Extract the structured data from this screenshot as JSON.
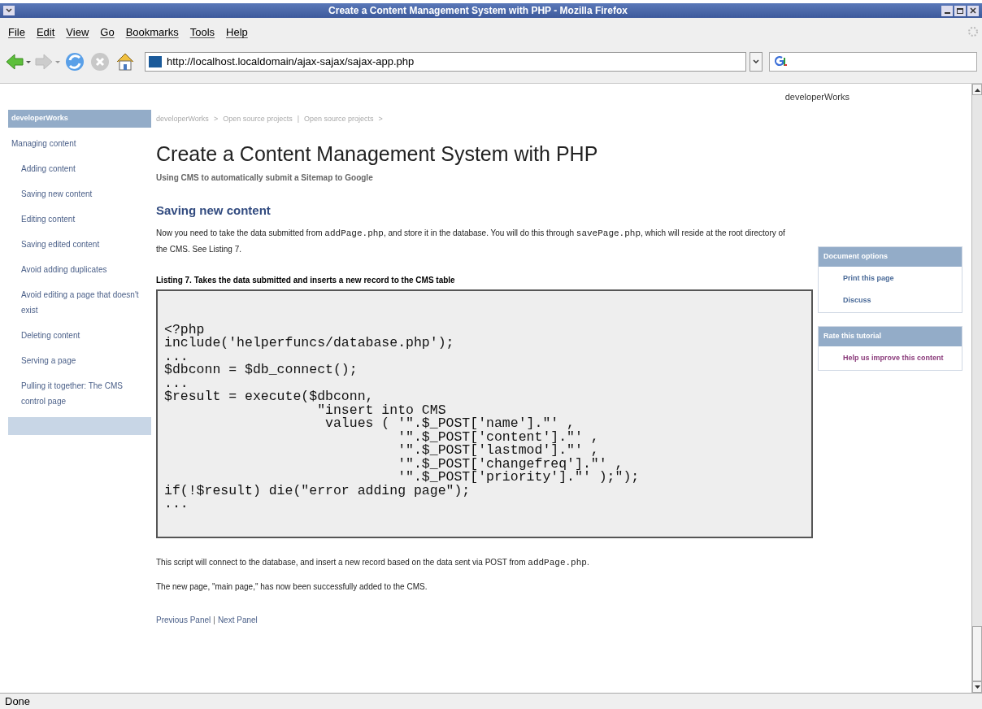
{
  "window": {
    "title": "Create a Content Management System with PHP - Mozilla Firefox"
  },
  "menu": [
    "File",
    "Edit",
    "View",
    "Go",
    "Bookmarks",
    "Tools",
    "Help"
  ],
  "address": {
    "value": "http://localhost.localdomain/ajax-sajax/sajax-app.php"
  },
  "page": {
    "site_label": "developerWorks",
    "sidebar": {
      "header": "developerWorks",
      "items": [
        {
          "label": "Managing content",
          "children": [
            {
              "label": "Adding content"
            },
            {
              "label": "Saving new content"
            },
            {
              "label": "Editing content"
            },
            {
              "label": "Saving edited content"
            },
            {
              "label": "Avoid adding duplicates"
            },
            {
              "label": "Avoid editing a page that doesn't exist"
            },
            {
              "label": "Deleting content"
            },
            {
              "label": "Serving a page"
            },
            {
              "label": "Pulling it together: The CMS control page"
            }
          ]
        }
      ]
    },
    "breadcrumb": [
      "developerWorks",
      ">",
      "Open source projects",
      "|",
      "Open source projects",
      ">"
    ],
    "title": "Create a Content Management System with PHP",
    "subtitle": "Using CMS to automatically submit a Sitemap to Google",
    "section_heading": "Saving new content",
    "intro": [
      {
        "text": "Now you need to take the data submitted from "
      },
      {
        "text": "addPage.php",
        "code": true
      },
      {
        "text": ", and store it in the database. You will do this through "
      },
      {
        "text": "savePage.php",
        "code": true
      },
      {
        "text": ", which will reside at the root directory of the CMS. See Listing 7."
      }
    ],
    "listing_caption": "Listing 7. Takes the data submitted and inserts a new record to the CMS table",
    "listing": [
      "<?php",
      "include('helperfuncs/database.php');",
      "...",
      "$dbconn = $db_connect();",
      "...",
      "$result = execute($dbconn,",
      "                   \"insert into CMS",
      "                    values ( '\".$_POST['name'].\"' ,",
      "                             '\".$_POST['content'].\"' ,",
      "                             '\".$_POST['lastmod'].\"' ,",
      "                             '\".$_POST['changefreq'].\"' ,",
      "                             '\".$_POST['priority'].\"' );\");",
      "if(!$result) die(\"error adding page\");",
      "..."
    ],
    "after": [
      [
        {
          "text": "This script will connect to the database, and insert a new record based on the data sent via POST from "
        },
        {
          "text": "addPage.php",
          "code": true
        },
        {
          "text": "."
        }
      ],
      [
        {
          "text": "The new page, \"main page,\" has now been successfully added to the CMS."
        }
      ]
    ],
    "pager": [
      "Previous Panel",
      "|",
      "Next Panel"
    ],
    "side_boxes": [
      {
        "header": "Document options",
        "links": [
          {
            "label": "Print this page",
            "visited": false
          },
          {
            "label": "Discuss",
            "visited": false
          }
        ]
      },
      {
        "header": "Rate this tutorial",
        "links": [
          {
            "label": "Help us improve this content",
            "visited": true
          }
        ]
      }
    ]
  },
  "status_bar": "Done"
}
